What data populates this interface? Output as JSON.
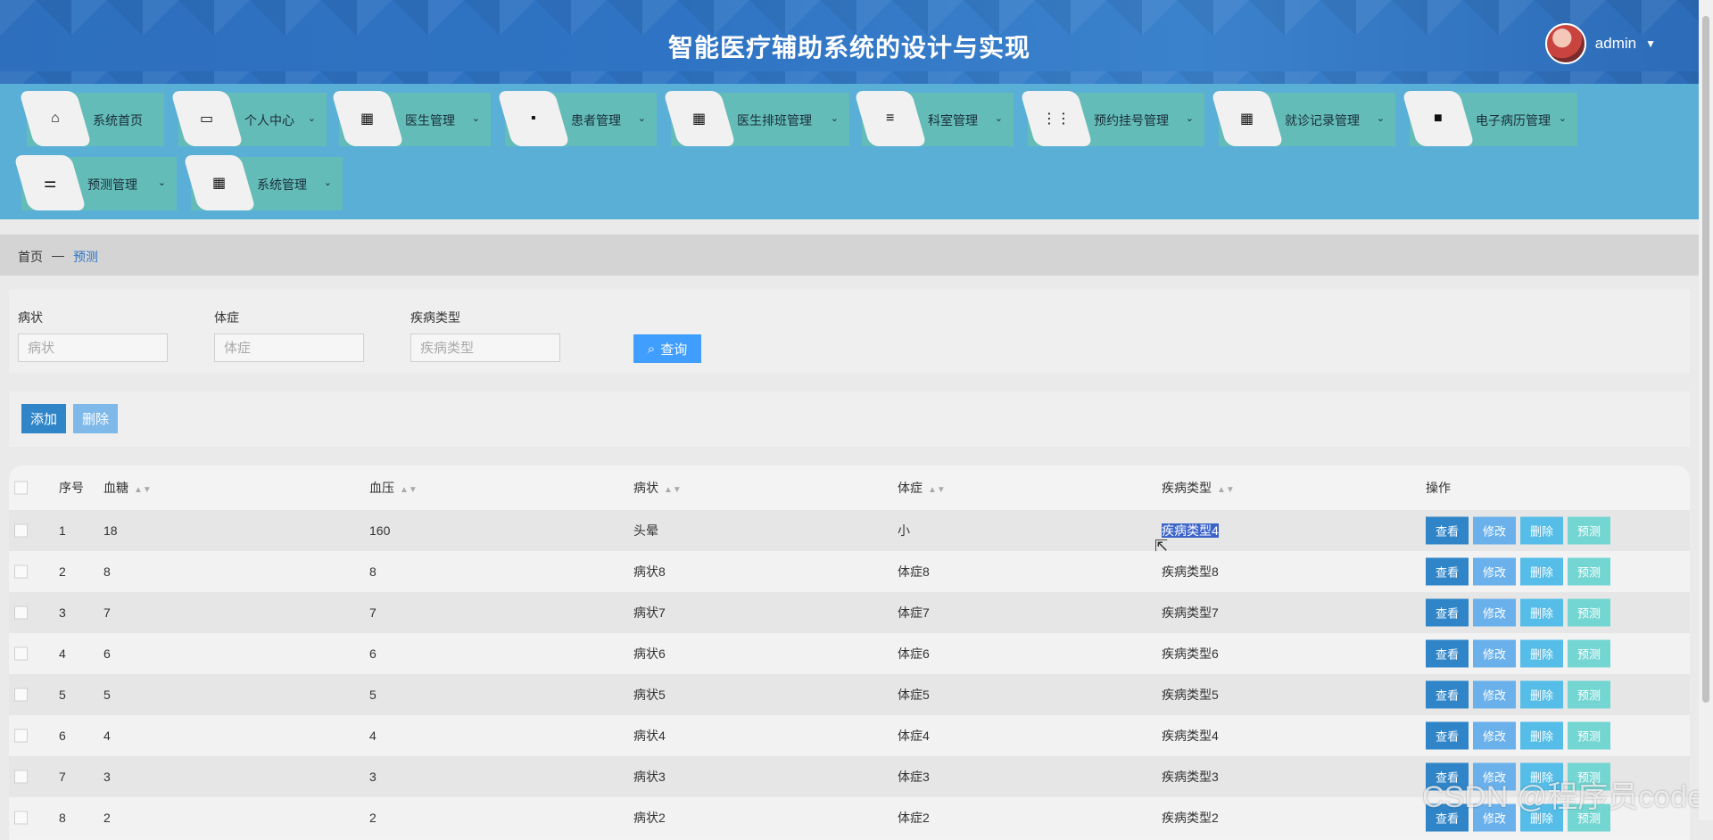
{
  "header": {
    "title": "智能医疗辅助系统的设计与实现",
    "username": "admin"
  },
  "nav": [
    {
      "label": "系统首页",
      "icon": "home-icon",
      "glyph": "⌂",
      "chevron": false
    },
    {
      "label": "个人中心",
      "icon": "card-icon",
      "glyph": "▭",
      "chevron": true
    },
    {
      "label": "医生管理",
      "icon": "grid-icon",
      "glyph": "▦",
      "chevron": true
    },
    {
      "label": "患者管理",
      "icon": "chat-icon",
      "glyph": "▪",
      "chevron": true
    },
    {
      "label": "医生排班管理",
      "icon": "grid-icon",
      "glyph": "▦",
      "chevron": true
    },
    {
      "label": "科室管理",
      "icon": "list-icon",
      "glyph": "≡",
      "chevron": true
    },
    {
      "label": "预约挂号管理",
      "icon": "apps-icon",
      "glyph": "⋮⋮",
      "chevron": true
    },
    {
      "label": "就诊记录管理",
      "icon": "grid-icon",
      "glyph": "▦",
      "chevron": true
    },
    {
      "label": "电子病历管理",
      "icon": "briefcase-icon",
      "glyph": "■",
      "chevron": true
    },
    {
      "label": "预测管理",
      "icon": "sliders-icon",
      "glyph": "⚌",
      "chevron": true
    },
    {
      "label": "系统管理",
      "icon": "grid-icon",
      "glyph": "▦",
      "chevron": true
    }
  ],
  "breadcrumb": {
    "home": "首页",
    "sep": "—",
    "current": "预测"
  },
  "search": {
    "fields": [
      {
        "label": "病状",
        "placeholder": "病状"
      },
      {
        "label": "体症",
        "placeholder": "体症"
      },
      {
        "label": "疾病类型",
        "placeholder": "疾病类型"
      }
    ],
    "query_label": "查询"
  },
  "actions": {
    "add": "添加",
    "delete": "删除"
  },
  "table": {
    "headers": {
      "index": "序号",
      "blood_sugar": "血糖",
      "blood_pressure": "血压",
      "symptom": "病状",
      "sign": "体症",
      "disease_type": "疾病类型",
      "ops": "操作"
    },
    "op_labels": {
      "view": "查看",
      "edit": "修改",
      "delete": "删除",
      "predict": "预测"
    },
    "rows": [
      {
        "index": "1",
        "blood_sugar": "18",
        "blood_pressure": "160",
        "symptom": "头晕",
        "sign": "小",
        "disease_type": "疾病类型4"
      },
      {
        "index": "2",
        "blood_sugar": "8",
        "blood_pressure": "8",
        "symptom": "病状8",
        "sign": "体症8",
        "disease_type": "疾病类型8"
      },
      {
        "index": "3",
        "blood_sugar": "7",
        "blood_pressure": "7",
        "symptom": "病状7",
        "sign": "体症7",
        "disease_type": "疾病类型7"
      },
      {
        "index": "4",
        "blood_sugar": "6",
        "blood_pressure": "6",
        "symptom": "病状6",
        "sign": "体症6",
        "disease_type": "疾病类型6"
      },
      {
        "index": "5",
        "blood_sugar": "5",
        "blood_pressure": "5",
        "symptom": "病状5",
        "sign": "体症5",
        "disease_type": "疾病类型5"
      },
      {
        "index": "6",
        "blood_sugar": "4",
        "blood_pressure": "4",
        "symptom": "病状4",
        "sign": "体症4",
        "disease_type": "疾病类型4"
      },
      {
        "index": "7",
        "blood_sugar": "3",
        "blood_pressure": "3",
        "symptom": "病状3",
        "sign": "体症3",
        "disease_type": "疾病类型3"
      },
      {
        "index": "8",
        "blood_sugar": "2",
        "blood_pressure": "2",
        "symptom": "病状2",
        "sign": "体症2",
        "disease_type": "疾病类型2"
      }
    ]
  },
  "watermark": "CSDN @程序员code"
}
